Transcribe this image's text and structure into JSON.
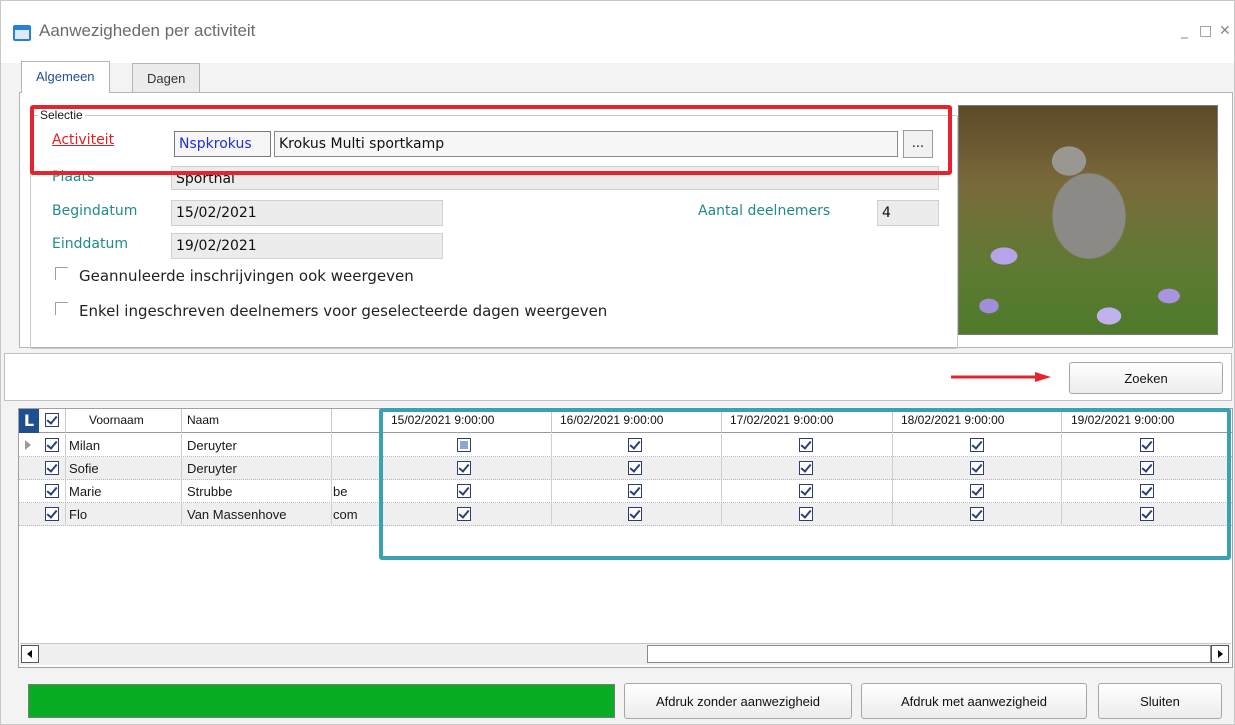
{
  "window": {
    "title": "Aanwezigheden per activiteit",
    "minimize": "_",
    "maximize": "□",
    "close": "✕"
  },
  "tabs": [
    {
      "label": "Algemeen",
      "active": true
    },
    {
      "label": "Dagen",
      "active": false
    }
  ],
  "selection": {
    "group_label": "Selectie",
    "activity_label": "Activiteit",
    "activity_code": "Nspkrokus",
    "activity_name": "Krokus Multi sportkamp",
    "browse_label": "...",
    "place_label": "Plaats",
    "place_value": "Sporthal",
    "start_label": "Begindatum",
    "start_value": "15/02/2021",
    "end_label": "Einddatum",
    "end_value": "19/02/2021",
    "participants_label": "Aantal deelnemers",
    "participants_value": "4",
    "option_cancelled": "Geannuleerde inschrijvingen ook weergeven",
    "option_registered_only": "Enkel ingeschreven deelnemers voor geselecteerde dagen weergeven"
  },
  "photo": {
    "icon": "squirrel-photo"
  },
  "search_button": "Zoeken",
  "grid": {
    "badge": "L",
    "columns": [
      "Voornaam",
      "Naam"
    ],
    "day_columns": [
      "15/02/2021 9:00:00",
      "16/02/2021 9:00:00",
      "17/02/2021 9:00:00",
      "18/02/2021 9:00:00",
      "19/02/2021 9:00:00"
    ],
    "rows": [
      {
        "first": "Milan",
        "last": "Deruyter",
        "extra": "",
        "days": [
          "partial",
          "checked",
          "checked",
          "checked",
          "checked"
        ]
      },
      {
        "first": "Sofie",
        "last": "Deruyter",
        "extra": "",
        "days": [
          "checked",
          "checked",
          "checked",
          "checked",
          "checked"
        ]
      },
      {
        "first": "Marie",
        "last": "Strubbe",
        "extra": "be",
        "days": [
          "checked",
          "checked",
          "checked",
          "checked",
          "checked"
        ]
      },
      {
        "first": "Flo",
        "last": "Van Massenhove",
        "extra": "com",
        "days": [
          "checked",
          "checked",
          "checked",
          "checked",
          "checked"
        ]
      }
    ]
  },
  "footer": {
    "progress_fraction": 1.0,
    "progress_color": "#08ad24",
    "print_without": "Afdruk zonder aanwezigheid",
    "print_with": "Afdruk met aanwezigheid",
    "close": "Sluiten"
  },
  "annotation_colors": {
    "red": "#e5242b",
    "teal": "#3aa1b5"
  }
}
